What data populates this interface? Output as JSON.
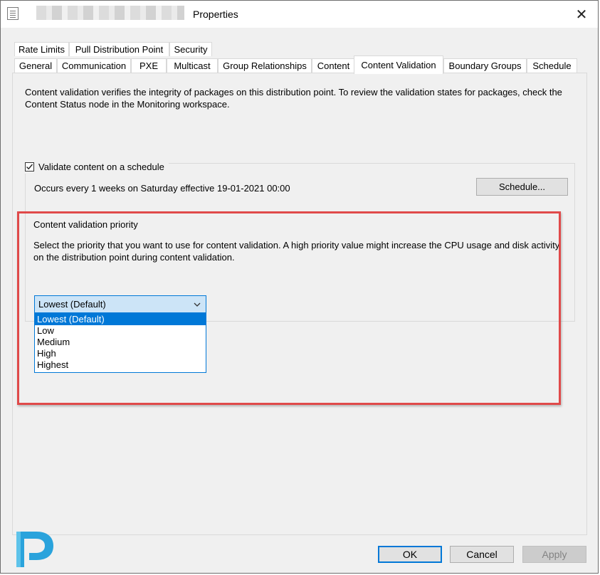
{
  "window": {
    "title": "Properties",
    "close_glyph": "✕",
    "icon": "properties-icon"
  },
  "tabs": {
    "row_top": [
      {
        "label": "Rate Limits"
      },
      {
        "label": "Pull Distribution Point"
      },
      {
        "label": "Security"
      }
    ],
    "row_bottom": [
      {
        "label": "General"
      },
      {
        "label": "Communication"
      },
      {
        "label": "PXE"
      },
      {
        "label": "Multicast"
      },
      {
        "label": "Group Relationships"
      },
      {
        "label": "Content"
      },
      {
        "label": "Content Validation",
        "active": true
      },
      {
        "label": "Boundary Groups"
      },
      {
        "label": "Schedule"
      }
    ]
  },
  "content_validation": {
    "description": "Content validation verifies the integrity of packages on this distribution point. To review the validation states for packages, check the Content Status node in the Monitoring workspace.",
    "schedule_checkbox_label": "Validate content on a schedule",
    "schedule_checked": true,
    "schedule_summary": "Occurs every 1 weeks on Saturday effective 19-01-2021 00:00",
    "schedule_button": "Schedule...",
    "priority_label": "Content validation priority",
    "priority_description": "Select the priority that you want to use for content validation. A high priority value might increase the CPU usage and disk activity on the distribution point during content validation.",
    "priority_selected": "Lowest (Default)",
    "priority_options": [
      "Lowest (Default)",
      "Low",
      "Medium",
      "High",
      "Highest"
    ]
  },
  "footer": {
    "ok": "OK",
    "cancel": "Cancel",
    "apply": "Apply"
  },
  "colors": {
    "accent": "#0078d7",
    "highlight": "#e04a4a",
    "logo": "#2aa3dc"
  }
}
